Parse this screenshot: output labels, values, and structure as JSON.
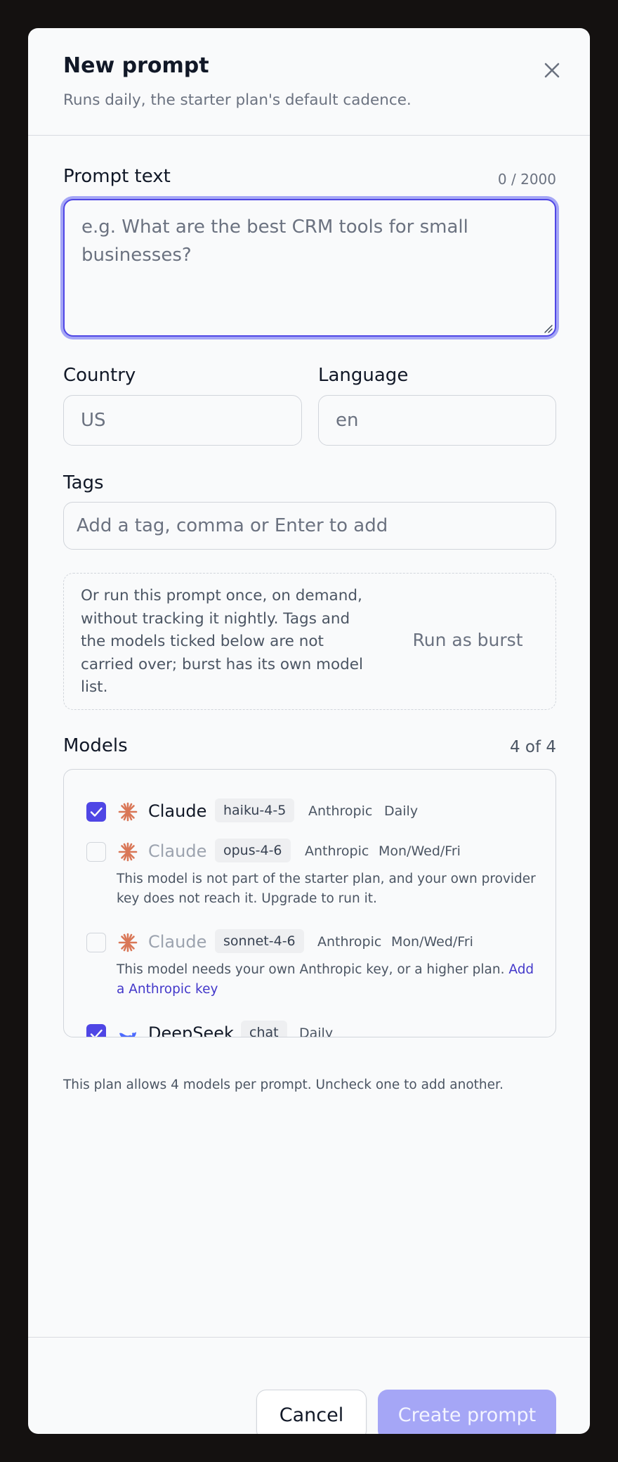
{
  "dialog": {
    "title": "New prompt",
    "subtitle": "Runs daily, the starter plan's default cadence."
  },
  "prompt": {
    "label": "Prompt text",
    "counter": "0 / 2000",
    "value": "",
    "placeholder": "e.g. What are the best CRM tools for small businesses?"
  },
  "country": {
    "label": "Country",
    "value": "",
    "placeholder": "US"
  },
  "language": {
    "label": "Language",
    "value": "",
    "placeholder": "en"
  },
  "tags": {
    "label": "Tags",
    "value": "",
    "placeholder": "Add a tag, comma or Enter to add"
  },
  "burst": {
    "text": "Or run this prompt once, on demand, without tracking it nightly. Tags and the models ticked below are not carried over; burst has its own model list.",
    "button": "Run as burst"
  },
  "models": {
    "label": "Models",
    "count": "4 of 4",
    "items": [
      {
        "checked": true,
        "enabled": true,
        "name": "Claude",
        "chip": "haiku-4-5",
        "provider": "Anthropic",
        "cadence": "Daily",
        "logo": "anthropic-icon",
        "logo_color": "#d97757"
      },
      {
        "checked": false,
        "enabled": false,
        "name": "Claude",
        "chip": "opus-4-6",
        "provider": "Anthropic",
        "cadence": "Mon/Wed/Fri",
        "logo": "anthropic-icon",
        "logo_color": "#d97757",
        "note": "This model is not part of the starter plan, and your own provider key does not reach it. Upgrade to run it."
      },
      {
        "checked": false,
        "enabled": false,
        "name": "Claude",
        "chip": "sonnet-4-6",
        "provider": "Anthropic",
        "cadence": "Mon/Wed/Fri",
        "logo": "anthropic-icon",
        "logo_color": "#d97757",
        "note": "This model needs your own Anthropic key, or a higher plan.",
        "note_link": "Add a Anthropic key"
      },
      {
        "checked": true,
        "enabled": true,
        "name": "DeepSeek",
        "chip": "chat",
        "cadence": "Daily",
        "logo": "deepseek-whale-icon",
        "logo_color": "#4d6bfe"
      }
    ],
    "plan_note": "This plan allows 4 models per prompt. Uncheck one to add another."
  },
  "footer": {
    "cancel": "Cancel",
    "create": "Create prompt"
  },
  "colors": {
    "accent": "#4f46e5",
    "accent_light": "#a5a6f6",
    "link": "#4338ca",
    "backdrop": "#141110",
    "surface": "#f9fafb"
  }
}
